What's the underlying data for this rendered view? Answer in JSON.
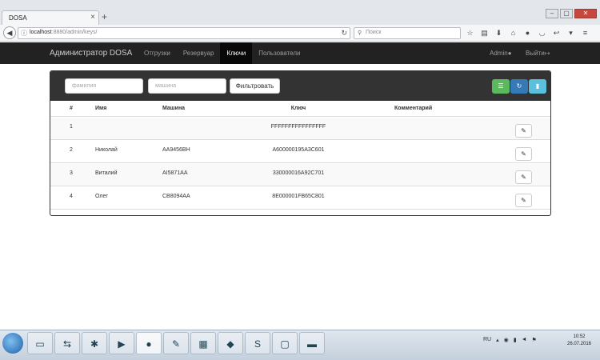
{
  "browser": {
    "tab_title": "DOSA",
    "tab_close": "×",
    "new_tab": "+",
    "url_host": "localhost",
    "url_rest": ":8880/admin/keys/",
    "search_placeholder": "Поиск",
    "window_buttons": [
      "–",
      "▢",
      "✕"
    ]
  },
  "app": {
    "brand": "Администратор DOSA",
    "menu": [
      {
        "label": "Отгрузки",
        "active": false
      },
      {
        "label": "Резервуар",
        "active": false
      },
      {
        "label": "Ключи",
        "active": true
      },
      {
        "label": "Пользователи",
        "active": false
      }
    ],
    "admin_label": "Admin",
    "logout_label": "Выйти"
  },
  "filter": {
    "surname_placeholder": "фамилия",
    "car_placeholder": "машина",
    "button_label": "Фильтровать"
  },
  "table": {
    "headers": {
      "num": "#",
      "name": "Имя",
      "car": "Машина",
      "key": "Ключ",
      "comment": "Комментарий"
    },
    "rows": [
      {
        "num": "1",
        "name": "",
        "car": "",
        "key": "FFFFFFFFFFFFFFFF",
        "comment": ""
      },
      {
        "num": "2",
        "name": "Николай",
        "car": "AA9456BH",
        "key": "A600000195A3C601",
        "comment": ""
      },
      {
        "num": "3",
        "name": "Виталий",
        "car": "AI5871AA",
        "key": "330000016A92C701",
        "comment": ""
      },
      {
        "num": "4",
        "name": "Олег",
        "car": "CB8094AA",
        "key": "8E000001FB65C801",
        "comment": ""
      }
    ]
  },
  "taskbar": {
    "language": "RU",
    "time": "10:52",
    "date": "26.07.2016"
  },
  "colors": {
    "appbar": "#222222",
    "green": "#5cb85c",
    "blue": "#337ab7",
    "cyan": "#5bc0de"
  }
}
